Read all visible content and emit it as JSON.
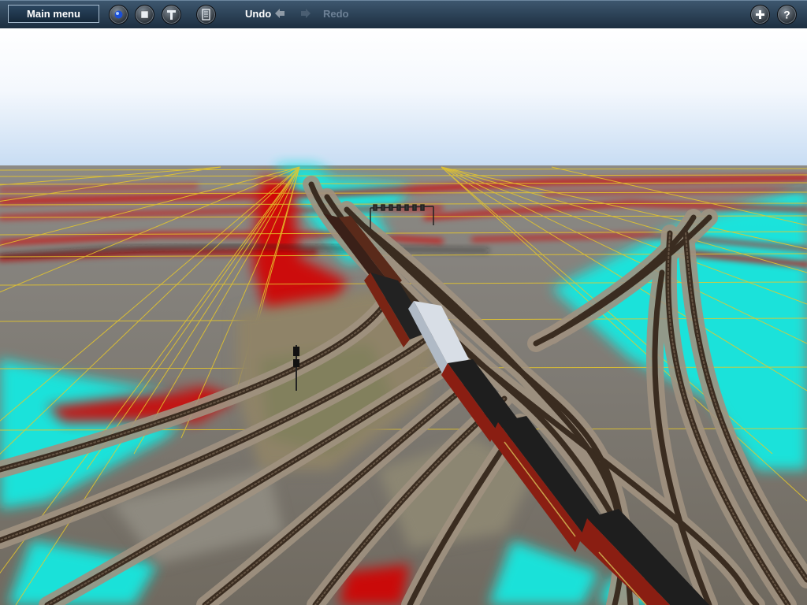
{
  "toolbar": {
    "main_menu_label": "Main menu",
    "undo_label": "Undo",
    "redo_label": "Redo",
    "icons": {
      "sun": "sun-icon",
      "stop": "stop-icon",
      "tools": "tools-icon",
      "calculator": "calculator-icon",
      "undo_arrow": "arrow-left-icon",
      "redo_arrow": "arrow-right-icon",
      "add": "plus-icon",
      "help": "help-icon"
    }
  },
  "colors": {
    "toolbar": "#253c52",
    "grid_line": "#e8c82a",
    "terrain": "#7d7870",
    "paint_cyan": "#19e8e0",
    "paint_red": "#d40000",
    "rail": "#3a2c20",
    "coach_red": "#8a1e12",
    "coach_roof": "#1e1e1e"
  }
}
